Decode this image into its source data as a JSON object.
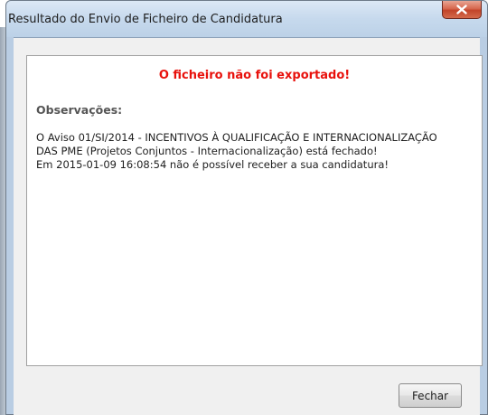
{
  "window": {
    "title": "Resultado do Envio de Ficheiro de Candidatura",
    "close_icon": "close-icon"
  },
  "message": {
    "headline": "O ficheiro não foi exportado!",
    "observations_label": "Observações:",
    "lines": [
      "O Aviso 01/SI/2014 - INCENTIVOS À QUALIFICAÇÃO E INTERNACIONALIZAÇÃO",
      "DAS PME (Projetos Conjuntos - Internacionalização) está fechado!",
      "Em 2015-01-09 16:08:54 não é possível receber a sua candidatura!"
    ]
  },
  "buttons": {
    "close_label": "Fechar"
  },
  "colors": {
    "headline": "#e8110c",
    "close_button_red": "#c2442a"
  }
}
